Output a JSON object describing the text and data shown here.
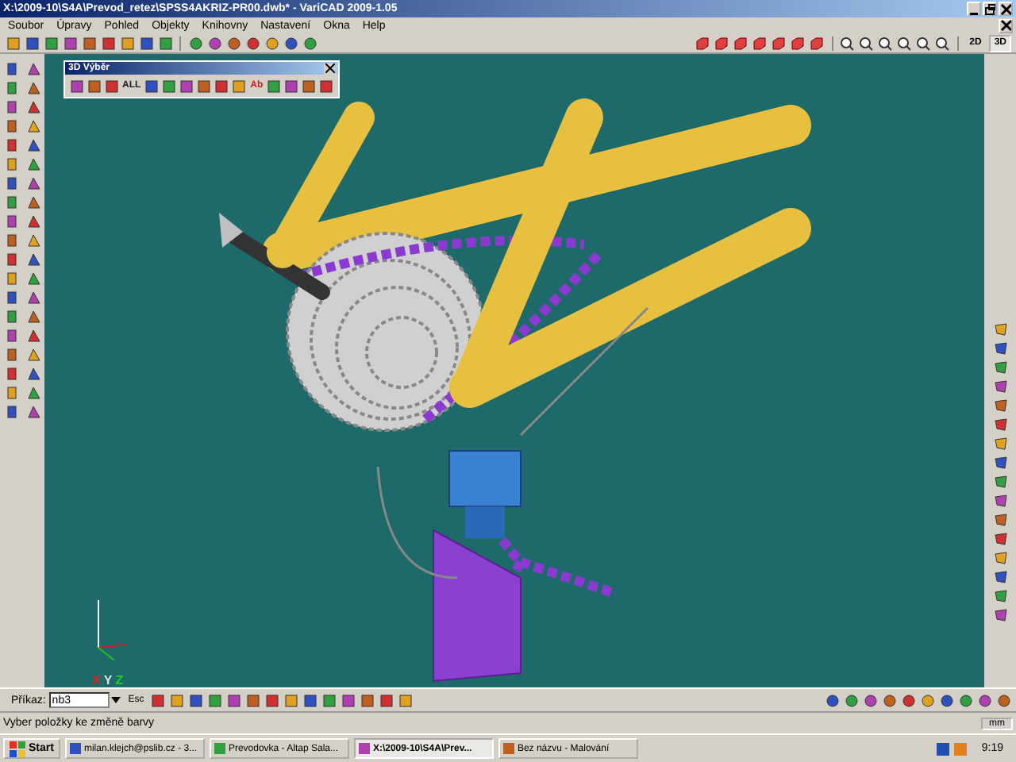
{
  "window": {
    "title": "X:\\2009-10\\S4A\\Prevod_retez\\SPSS4AKRIZ-PR00.dwb* - VariCAD 2009-1.05"
  },
  "menu": [
    "Soubor",
    "Úpravy",
    "Pohled",
    "Objekty",
    "Knihovny",
    "Nastavení",
    "Okna",
    "Help"
  ],
  "view_modes": [
    {
      "label": "2D",
      "selected": false
    },
    {
      "label": "3D",
      "selected": true
    }
  ],
  "selection_panel": {
    "title": "3D Výběr",
    "buttons": [
      {
        "kind": "icon"
      },
      {
        "kind": "icon"
      },
      {
        "kind": "icon"
      },
      {
        "kind": "text",
        "label": "ALL"
      },
      {
        "kind": "icon"
      },
      {
        "kind": "icon"
      },
      {
        "kind": "icon"
      },
      {
        "kind": "icon"
      },
      {
        "kind": "icon"
      },
      {
        "kind": "icon"
      },
      {
        "kind": "text",
        "label": "Ab"
      },
      {
        "kind": "icon"
      },
      {
        "kind": "icon"
      },
      {
        "kind": "icon"
      },
      {
        "kind": "icon"
      }
    ]
  },
  "axes": [
    "X",
    "Y",
    "Z"
  ],
  "command": {
    "label": "Příkaz:",
    "value": "nb3",
    "escape": "Esc"
  },
  "status_bar": {
    "message": "Vyber položky ke změně barvy",
    "units": "mm"
  },
  "taskbar": {
    "start": "Start",
    "tasks": [
      {
        "label": "milan.klejch@pslib.cz - 3...",
        "selected": false
      },
      {
        "label": "Prevodovka - Altap Sala...",
        "selected": false
      },
      {
        "label": "X:\\2009-10\\S4A\\Prev...",
        "selected": true
      },
      {
        "label": "Bez názvu - Malování",
        "selected": false
      }
    ],
    "clock": "9:19"
  }
}
